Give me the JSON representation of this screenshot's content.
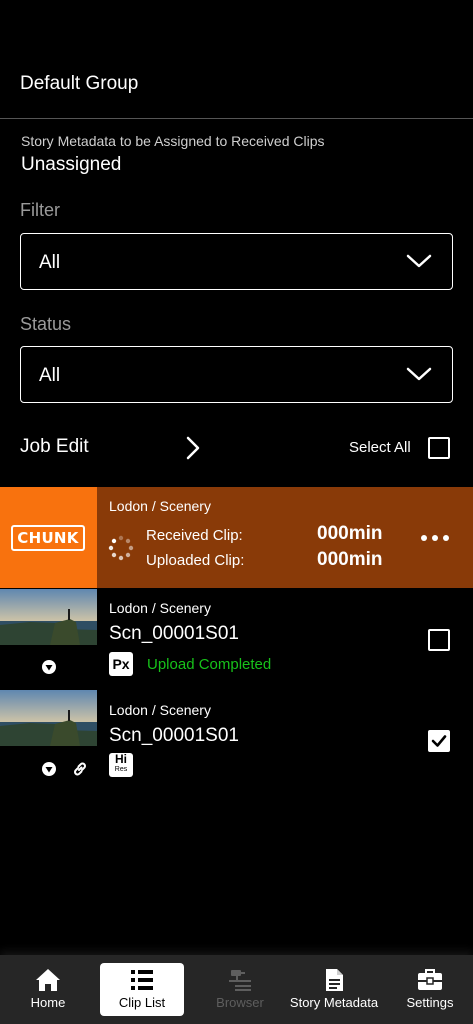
{
  "group": {
    "title": "Default Group"
  },
  "metadata": {
    "label": "Story Metadata to be Assigned to Received Clips",
    "value": "Unassigned"
  },
  "filter": {
    "label": "Filter",
    "value": "All"
  },
  "status": {
    "label": "Status",
    "value": "All"
  },
  "job_edit": {
    "label": "Job Edit",
    "select_all_label": "Select All",
    "select_all_checked": false
  },
  "chunk": {
    "badge": "CHUNK",
    "path": "Lodon / Scenery",
    "received_label": "Received Clip:",
    "received_value": "000min",
    "uploaded_label": "Uploaded Clip:",
    "uploaded_value": "000min",
    "menu_icon": "more-horizontal-icon"
  },
  "clips": [
    {
      "path": "Lodon / Scenery",
      "name": "Scn_00001S01",
      "badge": "Px",
      "status": "Upload Completed",
      "checked": false
    },
    {
      "path": "Lodon / Scenery",
      "name": "Scn_00001S01",
      "badge_top": "Hi",
      "badge_bottom": "Res",
      "checked": true
    }
  ],
  "colors": {
    "chunk_row": "#893a08",
    "chunk_thumb": "#f8720e",
    "success": "#17c11a",
    "tabbar": "#262626"
  },
  "tabs": [
    {
      "label": "Home",
      "icon": "home-icon",
      "active": false
    },
    {
      "label": "Clip List",
      "icon": "list-icon",
      "active": true
    },
    {
      "label": "Browser",
      "icon": "browser-icon",
      "active": false,
      "disabled": true
    },
    {
      "label": "Story Metadata",
      "icon": "document-icon",
      "active": false
    },
    {
      "label": "Settings",
      "icon": "toolbox-icon",
      "active": false
    }
  ]
}
